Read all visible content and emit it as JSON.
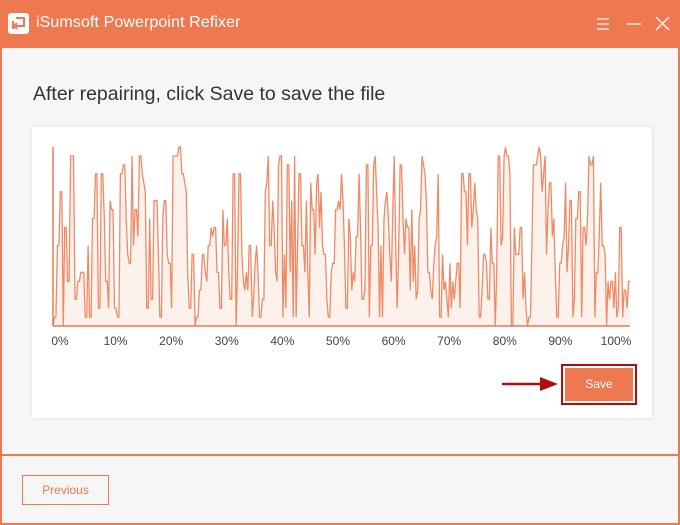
{
  "window": {
    "title": "iSumsoft Powerpoint Refixer",
    "controls": [
      "menu-icon",
      "minimize-icon",
      "close-icon"
    ]
  },
  "main": {
    "heading": "After repairing, click Save to save the file",
    "save_label": "Save",
    "previous_label": "Previous"
  },
  "colors": {
    "accent": "#ee7850",
    "highlight": "#b20d0d",
    "background": "#f6f6f6"
  },
  "chart_data": {
    "type": "area",
    "title": "",
    "xlabel": "",
    "ylabel": "",
    "x_tick_labels": [
      "0%",
      "10%",
      "20%",
      "30%",
      "40%",
      "50%",
      "60%",
      "70%",
      "80%",
      "90%",
      "100%"
    ],
    "xlim": [
      0,
      100
    ],
    "ylim": [
      0,
      1
    ],
    "grid": false,
    "legend": "none",
    "values": [
      0.0,
      0.05,
      0.05,
      0.45,
      0.45,
      0.75,
      0.75,
      0.0,
      0.55,
      0.55,
      0.25,
      0.25,
      0.95,
      0.95,
      0.95,
      0.15,
      0.15,
      0.25,
      0.25,
      0.3,
      0.3,
      0.3,
      0.05,
      0.05,
      0.45,
      0.05,
      0.05,
      0.6,
      0.6,
      0.85,
      0.85,
      0.1,
      0.1,
      0.85,
      0.85,
      0.6,
      0.25,
      0.25,
      0.1,
      0.7,
      0.65,
      0.65,
      0.1,
      0.1,
      0.05,
      0.05,
      0.85,
      0.85,
      0.9,
      0.9,
      0.6,
      0.4,
      0.35,
      0.35,
      0.95,
      0.45,
      0.65,
      0.65,
      0.5,
      0.95,
      0.95,
      0.85,
      0.8,
      0.75,
      0.1,
      0.1,
      0.6,
      0.15,
      0.15,
      0.7,
      0.7,
      0.7,
      0.4,
      0.05,
      0.05,
      0.6,
      0.7,
      0.7,
      0.4,
      0.35,
      0.35,
      0.1,
      0.95,
      0.95,
      0.95,
      0.95,
      1.0,
      1.0,
      0.85,
      0.85,
      0.8,
      0.75,
      0.3,
      0.1,
      0.1,
      0.4,
      0.4,
      0.0,
      0.05,
      0.05,
      0.2,
      0.2,
      0.4,
      0.4,
      0.3,
      0.25,
      0.45,
      0.45,
      0.55,
      0.5,
      0.55,
      0.55,
      0.3,
      0.3,
      0.1,
      0.1,
      0.65,
      0.45,
      0.45,
      0.6,
      0.3,
      0.15,
      0.15,
      0.85,
      0.85,
      0.0,
      0.3,
      0.85,
      0.85,
      0.4,
      0.25,
      0.2,
      0.3,
      0.2,
      0.45,
      0.45,
      0.05,
      0.15,
      0.35,
      0.45,
      0.3,
      0.05,
      0.05,
      0.15,
      0.15,
      0.75,
      0.8,
      0.95,
      0.45,
      0.45,
      0.7,
      0.55,
      0.3,
      0.25,
      0.9,
      0.95,
      0.95,
      0.05,
      0.4,
      0.1,
      0.9,
      0.9,
      0.3,
      0.7,
      0.05,
      0.95,
      0.05,
      0.45,
      0.85,
      0.85,
      0.45,
      0.45,
      0.3,
      0.7,
      0.3,
      0.05,
      0.8,
      0.65,
      0.65,
      0.4,
      0.8,
      0.85,
      0.55,
      0.75,
      0.45,
      0.4,
      0.4,
      0.15,
      0.05,
      0.05,
      0.3,
      0.35,
      0.35,
      0.65,
      0.65,
      0.7,
      0.65,
      0.85,
      0.7,
      0.45,
      0.1,
      0.1,
      0.6,
      0.5,
      0.2,
      0.3,
      0.25,
      0.5,
      0.5,
      0.85,
      0.55,
      0.15,
      0.15,
      0.2,
      0.9,
      0.9,
      0.05,
      0.45,
      0.45,
      0.9,
      0.95,
      0.75,
      0.55,
      0.05,
      0.45,
      0.05,
      0.6,
      0.7,
      0.75,
      0.6,
      0.4,
      0.25,
      0.65,
      0.95,
      0.45,
      0.1,
      0.4,
      0.9,
      0.9,
      0.6,
      0.4,
      0.6,
      0.55,
      0.55,
      0.2,
      0.65,
      0.25,
      0.45,
      0.15,
      0.2,
      0.6,
      0.65,
      0.95,
      0.9,
      0.85,
      0.7,
      0.3,
      0.3,
      0.2,
      0.15,
      0.35,
      0.45,
      0.5,
      0.85,
      0.05,
      0.05,
      0.4,
      0.2,
      0.25,
      0.15,
      0.05,
      0.35,
      0.1,
      0.25,
      0.15,
      0.25,
      0.35,
      0.35,
      0.1,
      0.85,
      0.85,
      0.75,
      0.75,
      0.45,
      0.85,
      0.85,
      0.55,
      0.65,
      0.8,
      0.65,
      0.6,
      0.05,
      0.05,
      0.2,
      0.4,
      0.4,
      0.35,
      0.15,
      0.15,
      0.55,
      0.35,
      0.35,
      0.0,
      0.3,
      0.95,
      0.95,
      0.45,
      0.5,
      0.95,
      1.0,
      0.95,
      0.95,
      0.85,
      0.0,
      0.0,
      0.55,
      0.4,
      0.4,
      0.4,
      0.55,
      0.55,
      0.15,
      0.3,
      0.1,
      0.0,
      0.05,
      0.05,
      0.45,
      0.9,
      0.9,
      0.9,
      0.95,
      1.0,
      0.95,
      0.75,
      0.85,
      0.95,
      0.4,
      0.65,
      0.8,
      0.8,
      0.5,
      0.6,
      0.3,
      0.05,
      0.05,
      0.35,
      0.35,
      0.45,
      0.5,
      0.8,
      0.3,
      0.45,
      0.7,
      0.7,
      0.05,
      0.15,
      0.6,
      0.6,
      0.75,
      0.75,
      0.05,
      0.55,
      0.55,
      0.45,
      0.6,
      0.95,
      0.9,
      0.9,
      0.95,
      0.05,
      0.3,
      0.3,
      0.5,
      0.8,
      0.45,
      0.45,
      0.4,
      0.0,
      0.25,
      0.15,
      0.25,
      0.25,
      0.1,
      0.3,
      0.05,
      0.1,
      0.55,
      0.55,
      0.05,
      0.2,
      0.2,
      0.1,
      0.25,
      0.25
    ]
  }
}
